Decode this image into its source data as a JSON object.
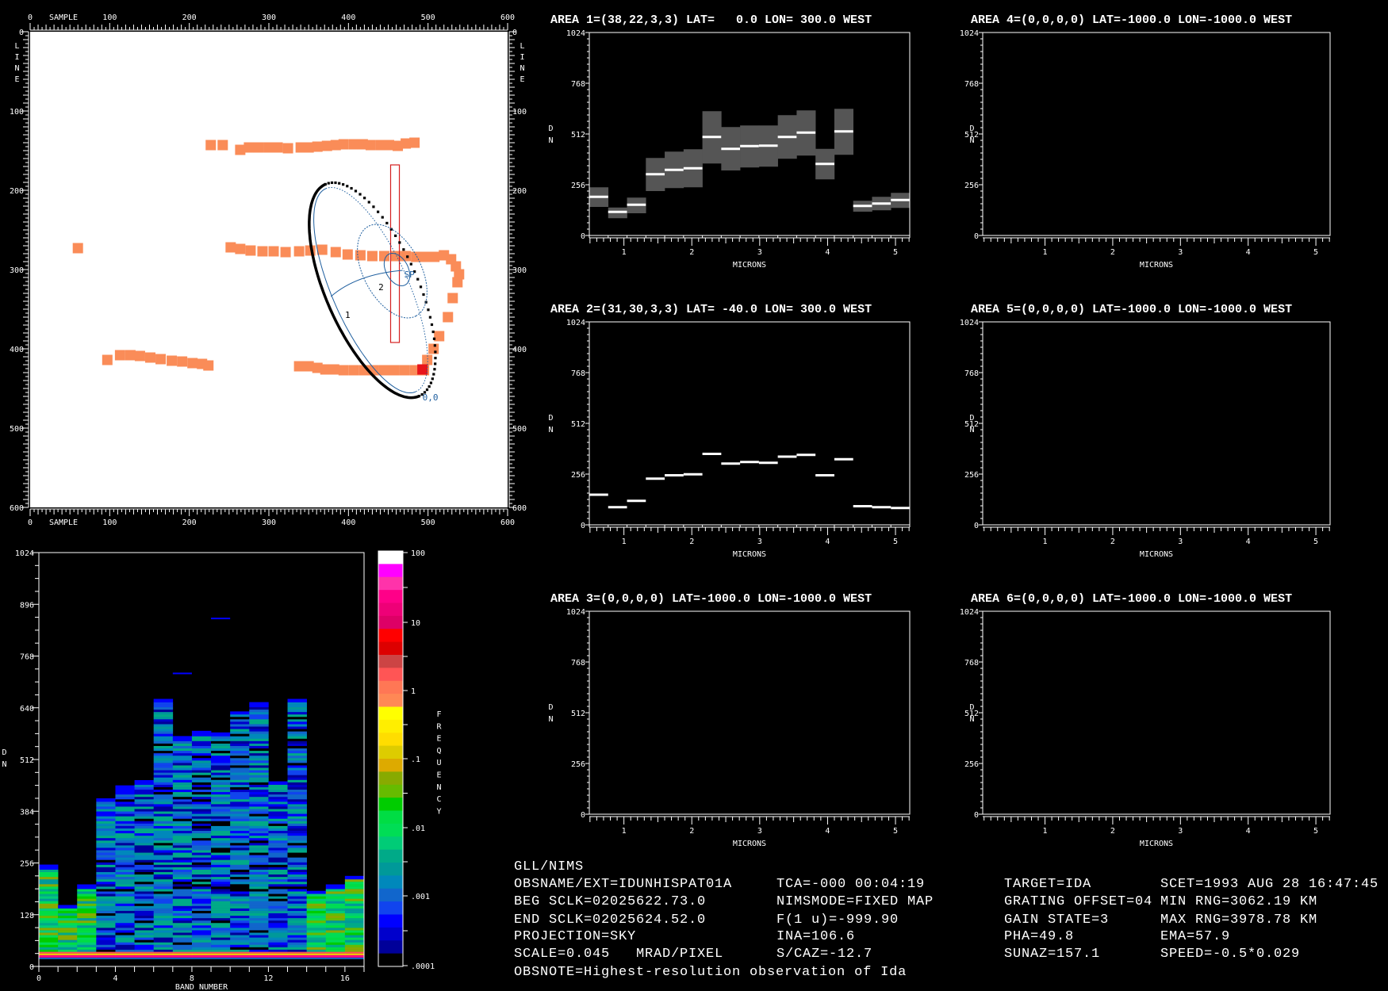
{
  "map": {
    "xlabel": "SAMPLE",
    "ylabel": "LINE",
    "tick_values": [
      0,
      100,
      200,
      300,
      400,
      500,
      600
    ],
    "tick_labels": [
      "0",
      "100",
      "200",
      "300",
      "400",
      "500",
      "600"
    ],
    "point_color": "#fa8c58",
    "highlight_color": "#e8141a",
    "points": [
      [
        227,
        143
      ],
      [
        242,
        143
      ],
      [
        264,
        149
      ],
      [
        275,
        146
      ],
      [
        287,
        146
      ],
      [
        300,
        146
      ],
      [
        311,
        146
      ],
      [
        324,
        147
      ],
      [
        340,
        146
      ],
      [
        350,
        146
      ],
      [
        361,
        145
      ],
      [
        373,
        144
      ],
      [
        384,
        143
      ],
      [
        394,
        142
      ],
      [
        407,
        142
      ],
      [
        418,
        142
      ],
      [
        428,
        143
      ],
      [
        441,
        143
      ],
      [
        451,
        143
      ],
      [
        462,
        144
      ],
      [
        472,
        141
      ],
      [
        483,
        140
      ],
      [
        60,
        273
      ],
      [
        252,
        272
      ],
      [
        264,
        274
      ],
      [
        277,
        276
      ],
      [
        292,
        277
      ],
      [
        306,
        277
      ],
      [
        321,
        278
      ],
      [
        338,
        277
      ],
      [
        352,
        276
      ],
      [
        367,
        275
      ],
      [
        384,
        278
      ],
      [
        399,
        281
      ],
      [
        415,
        282
      ],
      [
        430,
        283
      ],
      [
        445,
        283
      ],
      [
        459,
        283
      ],
      [
        472,
        283
      ],
      [
        485,
        284
      ],
      [
        497,
        284
      ],
      [
        508,
        284
      ],
      [
        520,
        282
      ],
      [
        529,
        287
      ],
      [
        535,
        296
      ],
      [
        539,
        306
      ],
      [
        537,
        316
      ],
      [
        531,
        336
      ],
      [
        525,
        360
      ],
      [
        514,
        384
      ],
      [
        507,
        400
      ],
      [
        499,
        414
      ],
      [
        97,
        414
      ],
      [
        113,
        408
      ],
      [
        126,
        408
      ],
      [
        138,
        409
      ],
      [
        151,
        411
      ],
      [
        164,
        413
      ],
      [
        178,
        415
      ],
      [
        191,
        416
      ],
      [
        204,
        418
      ],
      [
        216,
        419
      ],
      [
        224,
        421
      ],
      [
        338,
        422
      ],
      [
        350,
        422
      ],
      [
        361,
        424
      ],
      [
        371,
        426
      ],
      [
        382,
        426
      ],
      [
        394,
        427
      ],
      [
        407,
        427
      ],
      [
        420,
        427
      ],
      [
        432,
        427
      ],
      [
        445,
        427
      ],
      [
        457,
        427
      ],
      [
        470,
        427
      ],
      [
        483,
        427
      ],
      [
        495,
        427
      ]
    ],
    "highlight": [
      493,
      426
    ],
    "overlay_labels": {
      "lat1": "1",
      "lat2": "2",
      "pole": "SP",
      "origin": "0,0"
    }
  },
  "chart_data": [
    {
      "type": "heatmap",
      "xlabel": "BAND NUMBER",
      "ylabel": "DN",
      "xlim": [
        0,
        17
      ],
      "ylim": [
        0,
        1024
      ],
      "x_tick_values": [
        0,
        4,
        8,
        12,
        16
      ],
      "x_tick_labels": [
        "0",
        "4",
        "8",
        "12",
        "16"
      ],
      "y_tick_values": [
        0,
        128,
        256,
        384,
        512,
        640,
        768,
        896,
        1024
      ],
      "y_tick_labels": [
        "0",
        "128",
        "256",
        "384",
        "512",
        "640",
        "768",
        "896",
        "1024"
      ],
      "band_max_dn": [
        252,
        152,
        203,
        416,
        448,
        461,
        662,
        570,
        583,
        579,
        631,
        654,
        458,
        662,
        187,
        203,
        224
      ],
      "outliers": [
        [
          7,
          725
        ],
        [
          9,
          861
        ]
      ],
      "colorbar": {
        "label": "FREQUENCY",
        "scale": "log",
        "tick_labels": [
          "100",
          "10",
          "1",
          ".1",
          ".01",
          ".001",
          ".0001"
        ],
        "colors": [
          "#ffffff",
          "#ff00ff",
          "#ff33aa",
          "#ff0088",
          "#ee0077",
          "#dd0066",
          "#ff0000",
          "#dd0000",
          "#cc4444",
          "#ff5555",
          "#ff7755",
          "#ff8855",
          "#ffff00",
          "#ffee00",
          "#ffdd00",
          "#ddcc00",
          "#ddaa00",
          "#88aa00",
          "#66bb00",
          "#00cc00",
          "#00dd44",
          "#00dd55",
          "#00cc77",
          "#00aa88",
          "#009999",
          "#0088bb",
          "#1166cc",
          "#1144ee",
          "#0000ff",
          "#0000cc",
          "#000099",
          "#000000"
        ]
      }
    },
    {
      "type": "bar",
      "title": "AREA 1=(38,22,3,3) LAT=   0.0 LON= 300.0 WEST",
      "xlabel": "MICRONS",
      "ylabel": "DN",
      "xlim": [
        0.49,
        5.21
      ],
      "ylim": [
        0,
        1024
      ],
      "values": [
        195,
        119,
        155,
        309,
        331,
        339,
        497,
        437,
        451,
        453,
        497,
        519,
        361,
        525,
        149,
        161,
        179
      ],
      "min": [
        144,
        87,
        112,
        224,
        239,
        243,
        363,
        328,
        343,
        347,
        387,
        403,
        283,
        407,
        120,
        127,
        139
      ],
      "max": [
        243,
        141,
        191,
        391,
        423,
        435,
        627,
        547,
        555,
        555,
        607,
        631,
        437,
        639,
        175,
        195,
        215
      ]
    },
    {
      "type": "bar",
      "title": "AREA 2=(31,30,3,3) LAT= -40.0 LON= 300.0 WEST",
      "xlabel": "MICRONS",
      "ylabel": "DN",
      "xlim": [
        0.49,
        5.21
      ],
      "ylim": [
        0,
        1024
      ],
      "values": [
        152,
        89,
        121,
        233,
        250,
        255,
        358,
        309,
        317,
        313,
        344,
        353,
        250,
        331,
        94,
        89,
        85
      ]
    },
    {
      "type": "bar",
      "title": "AREA 3=(0,0,0,0) LAT=-1000.0 LON=-1000.0 WEST",
      "xlabel": "MICRONS",
      "ylabel": "DN",
      "xlim": [
        0.49,
        5.21
      ],
      "ylim": [
        0,
        1024
      ],
      "values": []
    },
    {
      "type": "bar",
      "title": "AREA 4=(0,0,0,0) LAT=-1000.0 LON=-1000.0 WEST",
      "xlabel": "MICRONS",
      "ylabel": "DN",
      "xlim": [
        0.08,
        5.21
      ],
      "ylim": [
        0,
        1024
      ],
      "values": []
    },
    {
      "type": "bar",
      "title": "AREA 5=(0,0,0,0) LAT=-1000.0 LON=-1000.0 WEST",
      "xlabel": "MICRONS",
      "ylabel": "DN",
      "xlim": [
        0.08,
        5.21
      ],
      "ylim": [
        0,
        1024
      ],
      "values": []
    },
    {
      "type": "bar",
      "title": "AREA 6=(0,0,0,0) LAT=-1000.0 LON=-1000.0 WEST",
      "xlabel": "MICRONS",
      "ylabel": "DN",
      "xlim": [
        0.08,
        5.21
      ],
      "ylim": [
        0,
        1024
      ],
      "values": []
    }
  ],
  "spectra_axes": {
    "y_tick_values": [
      0,
      256,
      512,
      768,
      1024
    ],
    "y_tick_labels": [
      "0",
      "256",
      "512",
      "768",
      "1024"
    ],
    "x_tick_values": [
      1,
      2,
      3,
      4,
      5
    ],
    "x_tick_labels": [
      "1",
      "2",
      "3",
      "4",
      "5"
    ]
  },
  "info": {
    "rows": [
      [
        "GLL/NIMS",
        "",
        "",
        ""
      ],
      [
        "OBSNAME/EXT=IDUNHISPAT01A",
        "TCA=-000 00:04:19",
        "TARGET=IDA",
        "SCET=1993 AUG 28 16:47:45"
      ],
      [
        "BEG SCLK=02025622.73.0",
        "NIMSMODE=FIXED MAP",
        "GRATING OFFSET=04",
        "MIN RNG=3062.19 KM"
      ],
      [
        "END SCLK=02025624.52.0",
        "F(1 u)=-999.90",
        "GAIN STATE=3",
        "MAX RNG=3978.78 KM"
      ],
      [
        "PROJECTION=SKY",
        "INA=106.6",
        "PHA=49.8",
        "EMA=57.9"
      ],
      [
        "SCALE=0.045   MRAD/PIXEL",
        "S/CAZ=-12.7",
        "SUNAZ=157.1",
        "SPEED=-0.5*0.029"
      ],
      [
        "OBSNOTE=Highest-resolution observation of Ida",
        "",
        "",
        ""
      ]
    ]
  }
}
